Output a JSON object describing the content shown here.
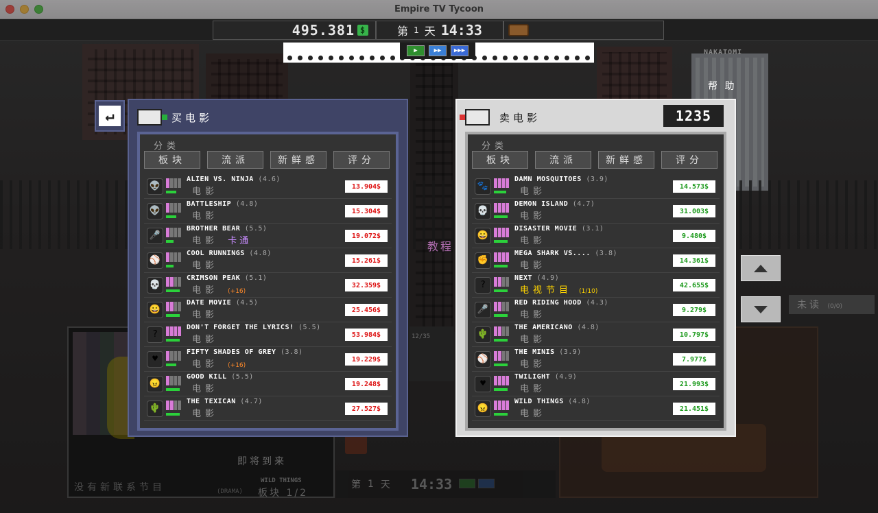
{
  "window": {
    "title": "Empire TV Tycoon"
  },
  "hud": {
    "money": "495.381",
    "money_icon": "coin-icon",
    "day_prefix": "第",
    "day_number": "1",
    "day_suffix": "天",
    "clock": "14:33"
  },
  "help_label": "帮 助",
  "building_sign": "NAKATOMI",
  "buy_panel": {
    "title": "买电影",
    "category_label": "分类",
    "tabs": [
      "板块",
      "流派",
      "新鲜感",
      "评分"
    ],
    "movies": [
      {
        "name": "ALIEN VS. NINJA",
        "rating": "(4.6)",
        "type": "电影",
        "tag": "",
        "price": "13.904$",
        "icon": "alien-icon",
        "glyph": "👽",
        "rating_level": 0.2,
        "fresh_level": 0.7
      },
      {
        "name": "BATTLESHIP",
        "rating": "(4.8)",
        "type": "电影",
        "tag": "",
        "price": "15.304$",
        "icon": "alien-icon",
        "glyph": "👽",
        "rating_level": 0.2,
        "fresh_level": 0.7
      },
      {
        "name": "BROTHER BEAR",
        "rating": "(5.5)",
        "type": "电影",
        "tag": "卡通",
        "tag_kind": "genre",
        "price": "19.072$",
        "icon": "microphone-icon",
        "glyph": "🎤",
        "rating_level": 0.2,
        "fresh_level": 0.5
      },
      {
        "name": "COOL RUNNINGS",
        "rating": "(4.8)",
        "type": "电影",
        "tag": "",
        "price": "15.261$",
        "icon": "ball-icon",
        "glyph": "⚾",
        "rating_level": 0.2,
        "fresh_level": 0.5
      },
      {
        "name": "CRIMSON PEAK",
        "rating": "(5.1)",
        "type": "电影",
        "tag": "(+16)",
        "tag_kind": "age",
        "price": "32.359$",
        "icon": "skull-icon",
        "glyph": "💀",
        "rating_level": 0.6,
        "fresh_level": 0.9
      },
      {
        "name": "DATE MOVIE",
        "rating": "(4.5)",
        "type": "电影",
        "tag": "",
        "price": "25.456$",
        "icon": "smile-icon",
        "glyph": "😀",
        "rating_level": 0.6,
        "fresh_level": 0.9
      },
      {
        "name": "DON'T FORGET THE LYRICS!",
        "rating": "(5.5)",
        "type": "电影",
        "tag": "",
        "price": "53.984$",
        "icon": "question-icon",
        "glyph": "?",
        "rating_level": 1.0,
        "fresh_level": 0.9
      },
      {
        "name": "FIFTY SHADES OF GREY",
        "rating": "(3.8)",
        "type": "电影",
        "tag": "(+16)",
        "tag_kind": "age",
        "price": "19.229$",
        "icon": "heart-icon",
        "glyph": "♥",
        "rating_level": 0.2,
        "fresh_level": 0.7
      },
      {
        "name": "GOOD KILL",
        "rating": "(5.5)",
        "type": "电影",
        "tag": "",
        "price": "19.248$",
        "icon": "angry-face-icon",
        "glyph": "😠",
        "rating_level": 0.2,
        "fresh_level": 0.9
      },
      {
        "name": "THE TEXICAN",
        "rating": "(4.7)",
        "type": "电影",
        "tag": "",
        "price": "27.527$",
        "icon": "cactus-icon",
        "glyph": "🌵",
        "rating_level": 0.6,
        "fresh_level": 0.9
      }
    ]
  },
  "sell_panel": {
    "title": "卖电影",
    "count": "1235",
    "category_label": "分类",
    "tabs": [
      "板块",
      "流派",
      "新鲜感",
      "评分"
    ],
    "movies": [
      {
        "name": "DAMN MOSQUITOES",
        "rating": "(3.9)",
        "type": "电影",
        "tag": "",
        "price": "14.573$",
        "icon": "paw-icon",
        "glyph": "🐾",
        "rating_level": 1.0,
        "fresh_level": 0.8
      },
      {
        "name": "DEMON ISLAND",
        "rating": "(4.7)",
        "type": "电影",
        "tag": "",
        "price": "31.003$",
        "icon": "skull-icon",
        "glyph": "💀",
        "rating_level": 1.0,
        "fresh_level": 0.9
      },
      {
        "name": "DISASTER MOVIE",
        "rating": "(3.1)",
        "type": "电影",
        "tag": "",
        "price": "9.480$",
        "icon": "smile-icon",
        "glyph": "😀",
        "rating_level": 1.0,
        "fresh_level": 0.9
      },
      {
        "name": "MEGA SHARK VS....",
        "rating": "(3.8)",
        "type": "电影",
        "tag": "",
        "price": "14.361$",
        "icon": "fist-icon",
        "glyph": "✊",
        "rating_level": 1.0,
        "fresh_level": 0.9
      },
      {
        "name": "NEXT",
        "rating": "(4.9)",
        "type": "电视节目",
        "tag": "(1/10)",
        "tag_kind": "episode",
        "price": "42.655$",
        "icon": "question-icon",
        "glyph": "?",
        "rating_level": 0.6,
        "fresh_level": 0.9
      },
      {
        "name": "RED RIDING HOOD",
        "rating": "(4.3)",
        "type": "电影",
        "tag": "",
        "price": "9.279$",
        "icon": "microphone-icon",
        "glyph": "🎤",
        "rating_level": 0.4,
        "fresh_level": 0.9
      },
      {
        "name": "THE AMERICANO",
        "rating": "(4.8)",
        "type": "电影",
        "tag": "",
        "price": "10.797$",
        "icon": "cactus-icon",
        "glyph": "🌵",
        "rating_level": 0.6,
        "fresh_level": 0.9
      },
      {
        "name": "THE MINIS",
        "rating": "(3.9)",
        "type": "电影",
        "tag": "",
        "price": "7.977$",
        "icon": "ball-icon",
        "glyph": "⚾",
        "rating_level": 0.6,
        "fresh_level": 0.9
      },
      {
        "name": "TWILIGHT",
        "rating": "(4.9)",
        "type": "电影",
        "tag": "",
        "price": "21.993$",
        "icon": "heart-icon",
        "glyph": "♥",
        "rating_level": 1.0,
        "fresh_level": 0.9
      },
      {
        "name": "WILD THINGS",
        "rating": "(4.8)",
        "type": "电影",
        "tag": "",
        "price": "21.451$",
        "icon": "angry-face-icon",
        "glyph": "😠",
        "rating_level": 1.0,
        "fresh_level": 0.9
      }
    ]
  },
  "tutorial_label": "教程",
  "unread": {
    "label": "未读",
    "count": "(0/0)"
  },
  "background": {
    "left_caption": "没有新联系节目",
    "coming_soon": "即将到来",
    "wild_things": "WILD THINGS",
    "genre_label": "(DRAMA)",
    "block_label": "板块 1/2",
    "mid_counter": "12/35",
    "bottom_day_prefix": "第",
    "bottom_day_number": "1",
    "bottom_day_suffix": "天",
    "bottom_clock": "14:33"
  },
  "colors": {
    "buy_panel": "#3f4466",
    "sell_panel": "#d8d8d8",
    "price_buy": "#dd1111",
    "price_sell": "#1c9a1c",
    "fresh_bar": "#2bd13b",
    "rating_block": "#d87cd8"
  }
}
